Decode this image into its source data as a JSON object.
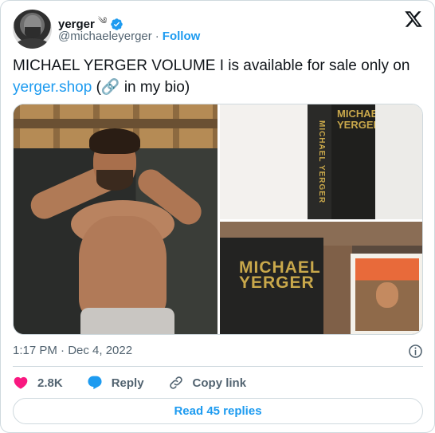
{
  "author": {
    "name": "yerger",
    "name_emoji": "༄",
    "handle": "@michaeleyerger",
    "separator": "·",
    "follow_label": "Follow"
  },
  "tweet": {
    "text_part1": "MICHAEL YERGER VOLUME I is available for sale only on ",
    "link_text": "yerger.shop",
    "text_part2": " (🔗 in my bio)"
  },
  "media": {
    "spine_text": "MICHAEL YERGER",
    "cover_text_top": "MICHAEL YERGER",
    "book_title_line1": "MICHAEL",
    "book_title_line2": "YERGER"
  },
  "meta": {
    "timestamp": "1:17 PM · Dec 4, 2022"
  },
  "actions": {
    "like_count": "2.8K",
    "reply_label": "Reply",
    "copy_label": "Copy link"
  },
  "read_replies_label": "Read 45 replies",
  "colors": {
    "accent": "#1d9bf0",
    "like": "#f91880",
    "muted": "#536471"
  }
}
